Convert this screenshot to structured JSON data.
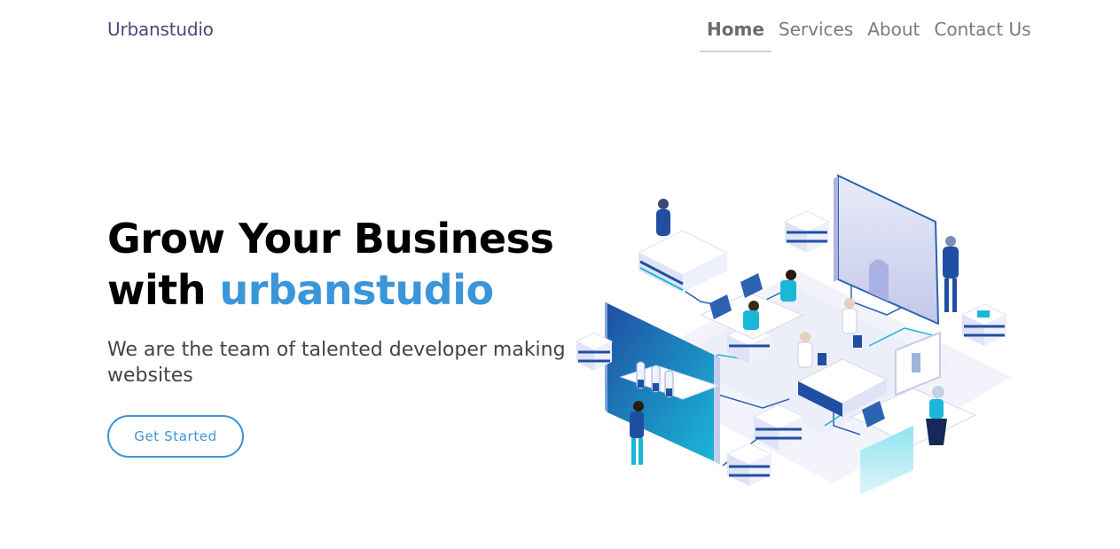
{
  "navbar": {
    "brand": "Urbanstudio",
    "links": [
      {
        "label": "Home",
        "active": true
      },
      {
        "label": "Services",
        "active": false
      },
      {
        "label": "About",
        "active": false
      },
      {
        "label": "Contact Us",
        "active": false
      }
    ]
  },
  "hero": {
    "title_line1": "Grow Your Business",
    "title_with": "with",
    "title_brand": "urbanstudio",
    "subtitle": "We are the team of talented developer making websites",
    "cta_label": "Get Started"
  },
  "colors": {
    "accent": "#3b95d9",
    "brand_text": "#4a4a7a",
    "nav_text": "#7a7a7a",
    "heading": "#000000"
  },
  "illustration": {
    "icon": "isometric-tech-office-illustration"
  }
}
